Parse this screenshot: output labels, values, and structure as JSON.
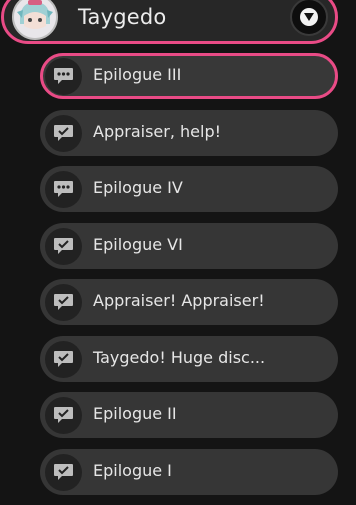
{
  "character": {
    "name": "Taygedo",
    "avatar_icon": "character-portrait-icon",
    "collapse_icon": "chevron-down-icon"
  },
  "quests": [
    {
      "label": "Epilogue III",
      "icon": "speech-bubble-dots-icon",
      "active": true
    },
    {
      "label": "Appraiser, help!",
      "icon": "speech-bubble-check-icon",
      "active": false
    },
    {
      "label": "Epilogue IV",
      "icon": "speech-bubble-dots-icon",
      "active": false
    },
    {
      "label": "Epilogue VI",
      "icon": "speech-bubble-check-icon",
      "active": false
    },
    {
      "label": "Appraiser! Appraiser!",
      "icon": "speech-bubble-check-icon",
      "active": false
    },
    {
      "label": "Taygedo! Huge disc...",
      "icon": "speech-bubble-check-icon",
      "active": false
    },
    {
      "label": "Epilogue II",
      "icon": "speech-bubble-check-icon",
      "active": false
    },
    {
      "label": "Epilogue I",
      "icon": "speech-bubble-check-icon",
      "active": false
    }
  ],
  "colors": {
    "accent": "#e94b86",
    "row_bg": "#363636",
    "badge_bg": "#222222",
    "page_bg": "#141414"
  }
}
